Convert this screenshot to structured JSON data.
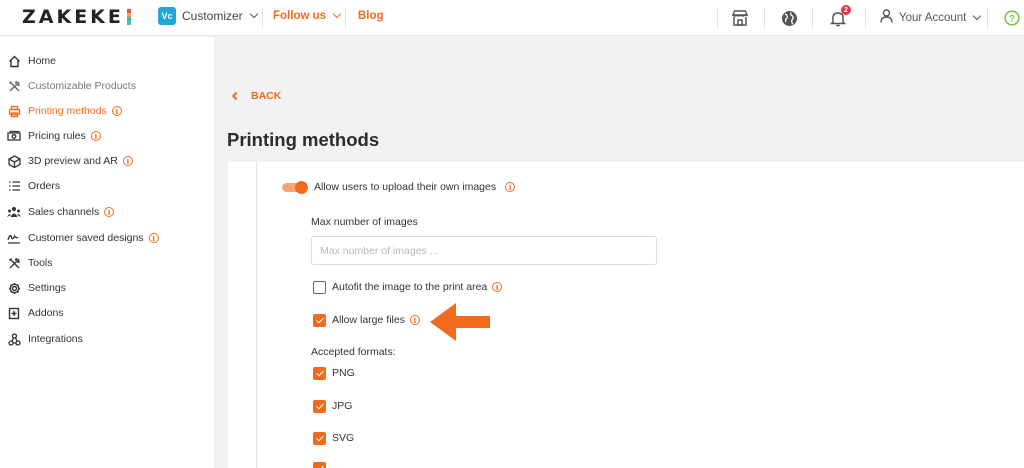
{
  "header": {
    "logo": "ZAKEKE",
    "app_badge": "Vc",
    "app_name": "Customizer",
    "follow_us": "Follow us",
    "blog": "Blog",
    "notification_count": "2",
    "account": "Your Account"
  },
  "sidebar": {
    "items": [
      {
        "label": "Home",
        "icon": "home-icon"
      },
      {
        "label": "Customizable Products",
        "icon": "tools-icon"
      },
      {
        "label": "Printing methods",
        "icon": "printer-icon"
      },
      {
        "label": "Pricing rules",
        "icon": "money-icon"
      },
      {
        "label": "3D preview and AR",
        "icon": "cube-icon"
      },
      {
        "label": "Orders",
        "icon": "list-icon"
      },
      {
        "label": "Sales channels",
        "icon": "channels-icon"
      },
      {
        "label": "Customer saved designs",
        "icon": "signature-icon"
      },
      {
        "label": "Tools",
        "icon": "tools-icon"
      },
      {
        "label": "Settings",
        "icon": "gear-icon"
      },
      {
        "label": "Addons",
        "icon": "addon-icon"
      },
      {
        "label": "Integrations",
        "icon": "integrations-icon"
      }
    ],
    "active_index": 2
  },
  "main": {
    "back_label": "BACK",
    "title": "Printing methods",
    "upload_toggle_label": "Allow users to upload their own images",
    "upload_toggle_on": true,
    "max_images_label": "Max number of images",
    "max_images_placeholder": "Max number of images ...",
    "max_images_value": "",
    "autofit_label": "Autofit the image to the print area",
    "autofit_checked": false,
    "large_files_label": "Allow large files",
    "large_files_checked": true,
    "accepted_formats_label": "Accepted formats:",
    "formats": [
      {
        "label": "PNG",
        "checked": true
      },
      {
        "label": "JPG",
        "checked": true
      },
      {
        "label": "SVG",
        "checked": true
      }
    ]
  },
  "colors": {
    "accent": "#f26b1d",
    "app_badge": "#1ea7d8",
    "notification": "#e0344b",
    "help": "#7ac943"
  }
}
